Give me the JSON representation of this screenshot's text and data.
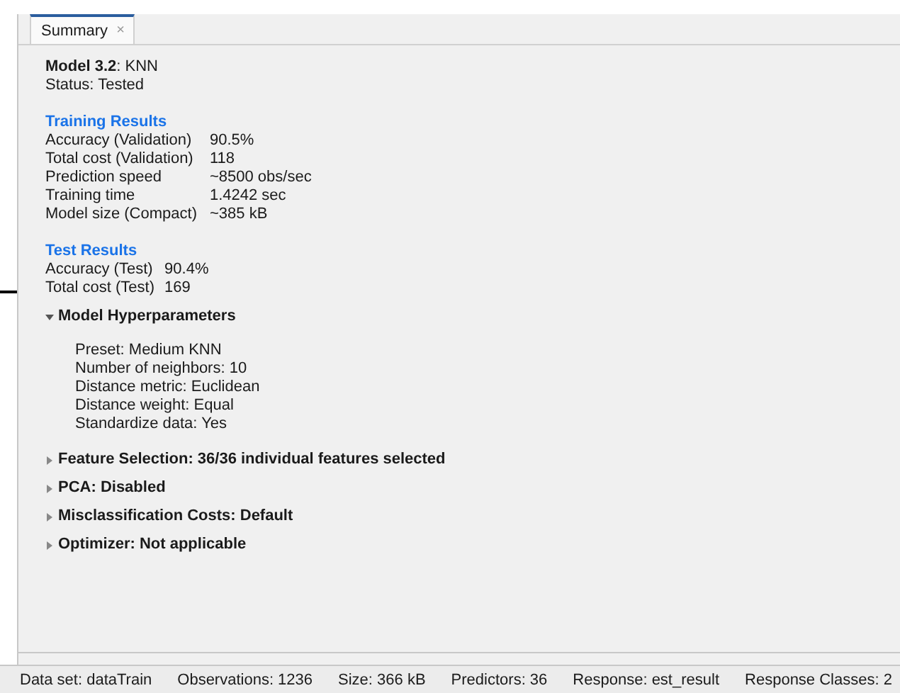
{
  "tabs": [
    {
      "label": "Summary",
      "selected": true,
      "close": "×"
    }
  ],
  "model": {
    "name": "Model 3.2",
    "type": ": KNN",
    "status": "Status: Tested"
  },
  "training_results": {
    "title": "Training Results",
    "rows": [
      {
        "label": "Accuracy (Validation)",
        "value": "90.5%"
      },
      {
        "label": "Total cost (Validation)",
        "value": "118"
      },
      {
        "label": "Prediction speed",
        "value": "~8500 obs/sec"
      },
      {
        "label": "Training time",
        "value": "1.4242 sec"
      },
      {
        "label": "Model size (Compact)",
        "value": "~385 kB"
      }
    ]
  },
  "test_results": {
    "title": "Test Results",
    "rows": [
      {
        "label": "Accuracy (Test)",
        "value": "90.4%"
      },
      {
        "label": "Total cost (Test)",
        "value": "169"
      }
    ]
  },
  "sections": [
    {
      "title": "Model Hyperparameters",
      "expanded": true,
      "lines": [
        "Preset: Medium KNN",
        "Number of neighbors: 10",
        "Distance metric: Euclidean",
        "Distance weight: Equal",
        "Standardize data: Yes"
      ]
    },
    {
      "title": "Feature Selection: 36/36 individual features selected",
      "expanded": false
    },
    {
      "title": "PCA: Disabled",
      "expanded": false
    },
    {
      "title": "Misclassification Costs: Default",
      "expanded": false
    },
    {
      "title": "Optimizer: Not applicable",
      "expanded": false
    }
  ],
  "status_bar": [
    "Data set: dataTrain",
    "Observations: 1236",
    "Size: 366 kB",
    "Predictors: 36",
    "Response: est_result",
    "Response Classes: 2"
  ]
}
